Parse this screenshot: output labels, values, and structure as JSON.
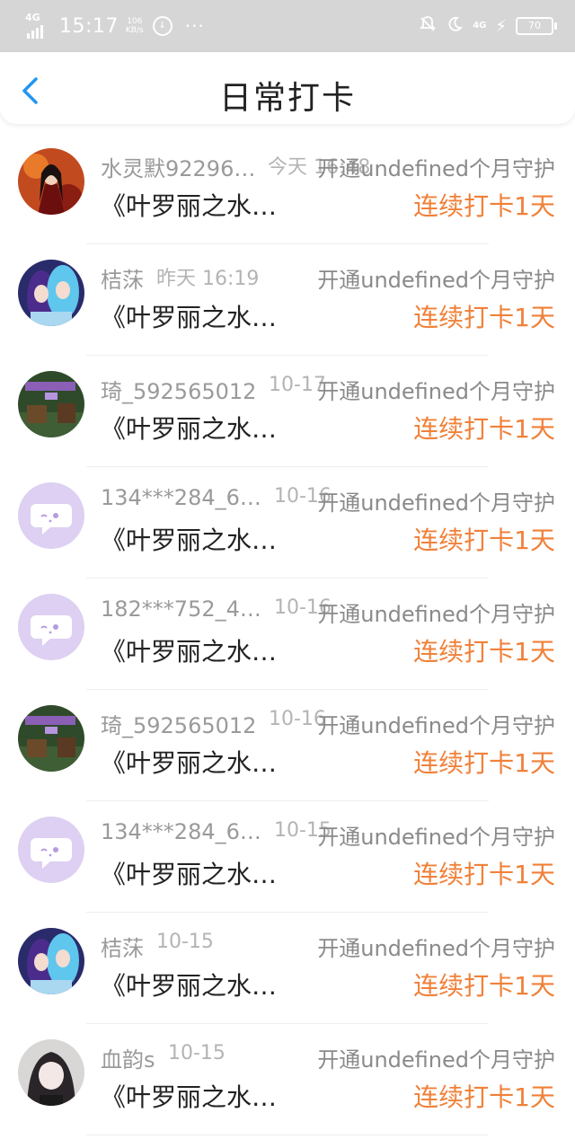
{
  "status_bar": {
    "network": "4G",
    "time": "15:17",
    "speed_value": "106",
    "speed_unit": "KB/s",
    "network_right": "4G",
    "battery": "70"
  },
  "header": {
    "title": "日常打卡"
  },
  "colors": {
    "accent": "#f0813a",
    "back": "#2196f3"
  },
  "rows": [
    {
      "name": "水灵默92296…",
      "time": "今天 16:48",
      "guard": "开通undefined个月守护",
      "book": "《叶罗丽之水…",
      "streak": "连续打卡1天",
      "avatar": "red-robe-girl"
    },
    {
      "name": "桔莯",
      "time": "昨天 16:19",
      "guard": "开通undefined个月守护",
      "book": "《叶罗丽之水…",
      "streak": "连续打卡1天",
      "avatar": "blue-hair-dolls"
    },
    {
      "name": "琦_592565012",
      "time": "10-17",
      "guard": "开通undefined个月守护",
      "book": "《叶罗丽之水…",
      "streak": "连续打卡1天",
      "avatar": "green-room"
    },
    {
      "name": "134***284_6…",
      "time": "10-16",
      "guard": "开通undefined个月守护",
      "book": "《叶罗丽之水…",
      "streak": "连续打卡1天",
      "avatar": "default-chat"
    },
    {
      "name": "182***752_4…",
      "time": "10-16",
      "guard": "开通undefined个月守护",
      "book": "《叶罗丽之水…",
      "streak": "连续打卡1天",
      "avatar": "default-chat"
    },
    {
      "name": "琦_592565012",
      "time": "10-16",
      "guard": "开通undefined个月守护",
      "book": "《叶罗丽之水…",
      "streak": "连续打卡1天",
      "avatar": "green-room"
    },
    {
      "name": "134***284_6…",
      "time": "10-15",
      "guard": "开通undefined个月守护",
      "book": "《叶罗丽之水…",
      "streak": "连续打卡1天",
      "avatar": "default-chat"
    },
    {
      "name": "桔莯",
      "time": "10-15",
      "guard": "开通undefined个月守护",
      "book": "《叶罗丽之水…",
      "streak": "连续打卡1天",
      "avatar": "blue-hair-dolls"
    },
    {
      "name": "血韵s",
      "time": "10-15",
      "guard": "开通undefined个月守护",
      "book": "《叶罗丽之水…",
      "streak": "连续打卡1天",
      "avatar": "dark-hair-girl"
    }
  ]
}
